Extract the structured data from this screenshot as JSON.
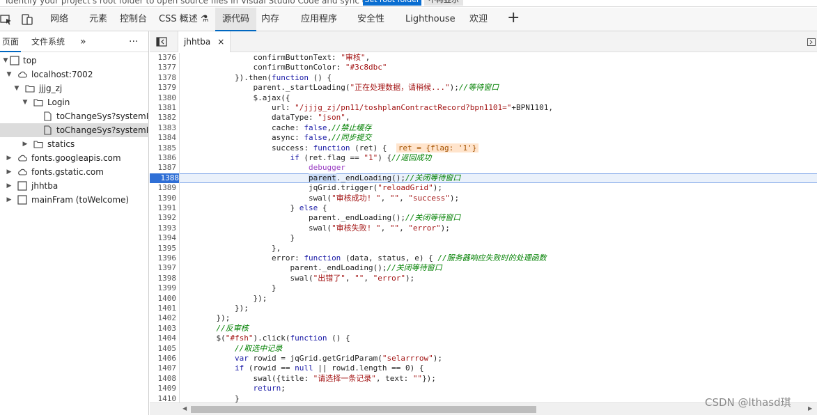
{
  "notice": {
    "text": "Identify your project's root folder to open source files in Visual Studio Code and sync changes.",
    "primary_button": "Set root folder",
    "secondary_button": "不再显示"
  },
  "tabs": [
    {
      "label": "网络"
    },
    {
      "label": "元素"
    },
    {
      "label": "控制台"
    },
    {
      "label": "CSS 概述 ⚗"
    },
    {
      "label": "源代码"
    },
    {
      "label": "内存"
    },
    {
      "label": "应用程序"
    },
    {
      "label": "安全性"
    },
    {
      "label": "Lighthouse"
    },
    {
      "label": "欢迎"
    }
  ],
  "left_tabs": {
    "page": "页面",
    "filesystem": "文件系统",
    "more": "»",
    "menu": "···"
  },
  "tree": [
    {
      "label": "top"
    },
    {
      "label": "localhost:7002"
    },
    {
      "label": "jjjg_zj"
    },
    {
      "label": "Login"
    },
    {
      "label": "toChangeSys?systemId=9"
    },
    {
      "label": "toChangeSys?systemId=9"
    },
    {
      "label": "statics"
    },
    {
      "label": "fonts.googleapis.com"
    },
    {
      "label": "fonts.gstatic.com"
    },
    {
      "label": "jhhtba"
    },
    {
      "label": "mainFram (toWelcome)"
    }
  ],
  "editor": {
    "file_tab": "jhhtba",
    "close": "×",
    "current_line": 1388
  },
  "code_lines": [
    {
      "n": "1376",
      "segs": [
        [
          "",
          "            confirmButtonText: "
        ],
        [
          "str",
          "\"审核\""
        ],
        [
          "",
          ","
        ]
      ]
    },
    {
      "n": "1377",
      "segs": [
        [
          "",
          "            confirmButtonColor: "
        ],
        [
          "str",
          "\"#3c8dbc\""
        ]
      ]
    },
    {
      "n": "1378",
      "segs": [
        [
          "",
          "        }).then("
        ],
        [
          "kw",
          "function"
        ],
        [
          "",
          " () {"
        ]
      ]
    },
    {
      "n": "1379",
      "segs": [
        [
          "",
          "            parent._startLoading("
        ],
        [
          "str",
          "\"正在处理数据，请稍候...\""
        ],
        [
          "",
          ");"
        ],
        [
          "cm",
          "//等待窗口"
        ]
      ]
    },
    {
      "n": "1380",
      "segs": [
        [
          "",
          "            $.ajax({"
        ]
      ]
    },
    {
      "n": "1381",
      "segs": [
        [
          "",
          "                url: "
        ],
        [
          "str",
          "\"/jjjg_zj/pn11/toshplanContractRecord?bpn1101=\""
        ],
        [
          "",
          "+BPN1101,"
        ]
      ]
    },
    {
      "n": "1382",
      "segs": [
        [
          "",
          "                dataType: "
        ],
        [
          "str",
          "\"json\""
        ],
        [
          "",
          ","
        ]
      ]
    },
    {
      "n": "1383",
      "segs": [
        [
          "",
          "                cache: "
        ],
        [
          "kw",
          "false"
        ],
        [
          "",
          ","
        ],
        [
          "cm",
          "//禁止缓存"
        ]
      ]
    },
    {
      "n": "1384",
      "segs": [
        [
          "",
          "                async: "
        ],
        [
          "kw",
          "false"
        ],
        [
          "",
          ","
        ],
        [
          "cm",
          "//同步提交"
        ]
      ]
    },
    {
      "n": "1385",
      "segs": [
        [
          "",
          "                success: "
        ],
        [
          "kw",
          "function"
        ],
        [
          "",
          " (ret) {  "
        ],
        [
          "inlinev",
          "ret = {flag: '1'}"
        ]
      ]
    },
    {
      "n": "1386",
      "segs": [
        [
          "",
          "                    "
        ],
        [
          "kw",
          "if"
        ],
        [
          "",
          " (ret.flag == "
        ],
        [
          "str",
          "\"1\""
        ],
        [
          "",
          ") {"
        ],
        [
          "cm",
          "//返回成功"
        ]
      ]
    },
    {
      "n": "1387",
      "segs": [
        [
          "",
          "                        "
        ],
        [
          "dbg",
          "debugger"
        ]
      ]
    },
    {
      "n": "1388",
      "segs": [
        [
          "",
          "                        "
        ],
        [
          "selword",
          "parent"
        ],
        [
          "",
          "._endLoading();"
        ],
        [
          "cm",
          "//关闭等待窗口"
        ]
      ]
    },
    {
      "n": "1389",
      "segs": [
        [
          "",
          "                        jqGrid.trigger("
        ],
        [
          "str",
          "\"reloadGrid\""
        ],
        [
          "",
          ");"
        ]
      ]
    },
    {
      "n": "1390",
      "segs": [
        [
          "",
          "                        swal("
        ],
        [
          "str",
          "\"审核成功! \""
        ],
        [
          "",
          ", "
        ],
        [
          "str",
          "\"\""
        ],
        [
          "",
          ", "
        ],
        [
          "str",
          "\"success\""
        ],
        [
          "",
          ");"
        ]
      ]
    },
    {
      "n": "1391",
      "segs": [
        [
          "",
          "                    } "
        ],
        [
          "kw",
          "else"
        ],
        [
          "",
          " {"
        ]
      ]
    },
    {
      "n": "1392",
      "segs": [
        [
          "",
          "                        parent._endLoading();"
        ],
        [
          "cm",
          "//关闭等待窗口"
        ]
      ]
    },
    {
      "n": "1393",
      "segs": [
        [
          "",
          "                        swal("
        ],
        [
          "str",
          "\"审核失败! \""
        ],
        [
          "",
          ", "
        ],
        [
          "str",
          "\"\""
        ],
        [
          "",
          ", "
        ],
        [
          "str",
          "\"error\""
        ],
        [
          "",
          ");"
        ]
      ]
    },
    {
      "n": "1394",
      "segs": [
        [
          "",
          "                    }"
        ]
      ]
    },
    {
      "n": "1395",
      "segs": [
        [
          "",
          "                },"
        ]
      ]
    },
    {
      "n": "1396",
      "segs": [
        [
          "",
          "                error: "
        ],
        [
          "kw",
          "function"
        ],
        [
          "",
          " (data, status, e) { "
        ],
        [
          "cm",
          "//服务器响应失败时的处理函数"
        ]
      ]
    },
    {
      "n": "1397",
      "segs": [
        [
          "",
          "                    parent._endLoading();"
        ],
        [
          "cm",
          "//关闭等待窗口"
        ]
      ]
    },
    {
      "n": "1398",
      "segs": [
        [
          "",
          "                    swal("
        ],
        [
          "str",
          "\"出错了\""
        ],
        [
          "",
          ", "
        ],
        [
          "str",
          "\"\""
        ],
        [
          "",
          ", "
        ],
        [
          "str",
          "\"error\""
        ],
        [
          "",
          ");"
        ]
      ]
    },
    {
      "n": "1399",
      "segs": [
        [
          "",
          "                }"
        ]
      ]
    },
    {
      "n": "1400",
      "segs": [
        [
          "",
          "            });"
        ]
      ]
    },
    {
      "n": "1401",
      "segs": [
        [
          "",
          "        });"
        ]
      ]
    },
    {
      "n": "1402",
      "segs": [
        [
          "",
          "    });"
        ]
      ]
    },
    {
      "n": "1403",
      "segs": [
        [
          "",
          "    "
        ],
        [
          "cm",
          "//反审核"
        ]
      ]
    },
    {
      "n": "1404",
      "segs": [
        [
          "",
          "    $("
        ],
        [
          "str",
          "\"#fsh\""
        ],
        [
          "",
          ").click("
        ],
        [
          "kw",
          "function"
        ],
        [
          "",
          " () {"
        ]
      ]
    },
    {
      "n": "1405",
      "segs": [
        [
          "",
          "        "
        ],
        [
          "cm",
          "//取选中记录"
        ]
      ]
    },
    {
      "n": "1406",
      "segs": [
        [
          "",
          "        "
        ],
        [
          "kw",
          "var"
        ],
        [
          "",
          " rowid = jqGrid.getGridParam("
        ],
        [
          "str",
          "\"selarrrow\""
        ],
        [
          "",
          ");"
        ]
      ]
    },
    {
      "n": "1407",
      "segs": [
        [
          "",
          "        "
        ],
        [
          "kw",
          "if"
        ],
        [
          "",
          " (rowid == "
        ],
        [
          "kw",
          "null"
        ],
        [
          "",
          " || rowid.length == 0) {"
        ]
      ]
    },
    {
      "n": "1408",
      "segs": [
        [
          "",
          "            swal({title: "
        ],
        [
          "str",
          "\"请选择一条记录\""
        ],
        [
          "",
          ", text: "
        ],
        [
          "str",
          "\"\""
        ],
        [
          "",
          "});"
        ]
      ]
    },
    {
      "n": "1409",
      "segs": [
        [
          "",
          "            "
        ],
        [
          "kw",
          "return"
        ],
        [
          "",
          ";"
        ]
      ]
    },
    {
      "n": "1410",
      "segs": [
        [
          "",
          "        }"
        ]
      ]
    },
    {
      "n": "1411",
      "segs": [
        [
          "",
          ""
        ]
      ]
    }
  ],
  "watermark": "CSDN @lthasd琪",
  "colors": {
    "accent": "#0067c0",
    "current_line": "#2f6fd6",
    "keyword": "#1a1aa6",
    "string": "#a31515",
    "comment": "#008000"
  }
}
